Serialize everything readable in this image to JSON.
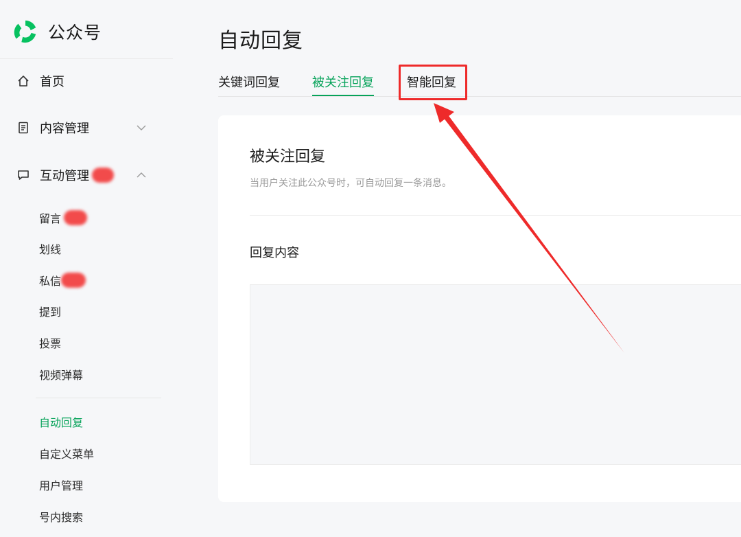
{
  "brand": {
    "name": "公众号",
    "logo_icon": "wechat-official-account-logo",
    "accent": "#07c160"
  },
  "sidebar": {
    "items": [
      {
        "label": "首页",
        "icon": "home-icon"
      },
      {
        "label": "内容管理",
        "icon": "document-icon",
        "expanded": false
      },
      {
        "label": "互动管理",
        "icon": "comment-icon",
        "expanded": true
      }
    ],
    "sub_items": [
      {
        "label": "留言"
      },
      {
        "label": "划线"
      },
      {
        "label": "私信"
      },
      {
        "label": "提到"
      },
      {
        "label": "投票"
      },
      {
        "label": "视频弹幕"
      },
      {
        "label": "自动回复",
        "active": true
      },
      {
        "label": "自定义菜单"
      },
      {
        "label": "用户管理"
      },
      {
        "label": "号内搜索"
      }
    ]
  },
  "main": {
    "title": "自动回复",
    "tabs": [
      {
        "label": "关键词回复"
      },
      {
        "label": "被关注回复",
        "active": true
      },
      {
        "label": "智能回复",
        "highlighted": true
      }
    ],
    "card": {
      "title": "被关注回复",
      "description": "当用户关注此公众号时，可自动回复一条消息。",
      "section_label": "回复内容"
    }
  },
  "colors": {
    "accent_green": "#07a35a",
    "annotation_red": "#ee2a2a"
  }
}
